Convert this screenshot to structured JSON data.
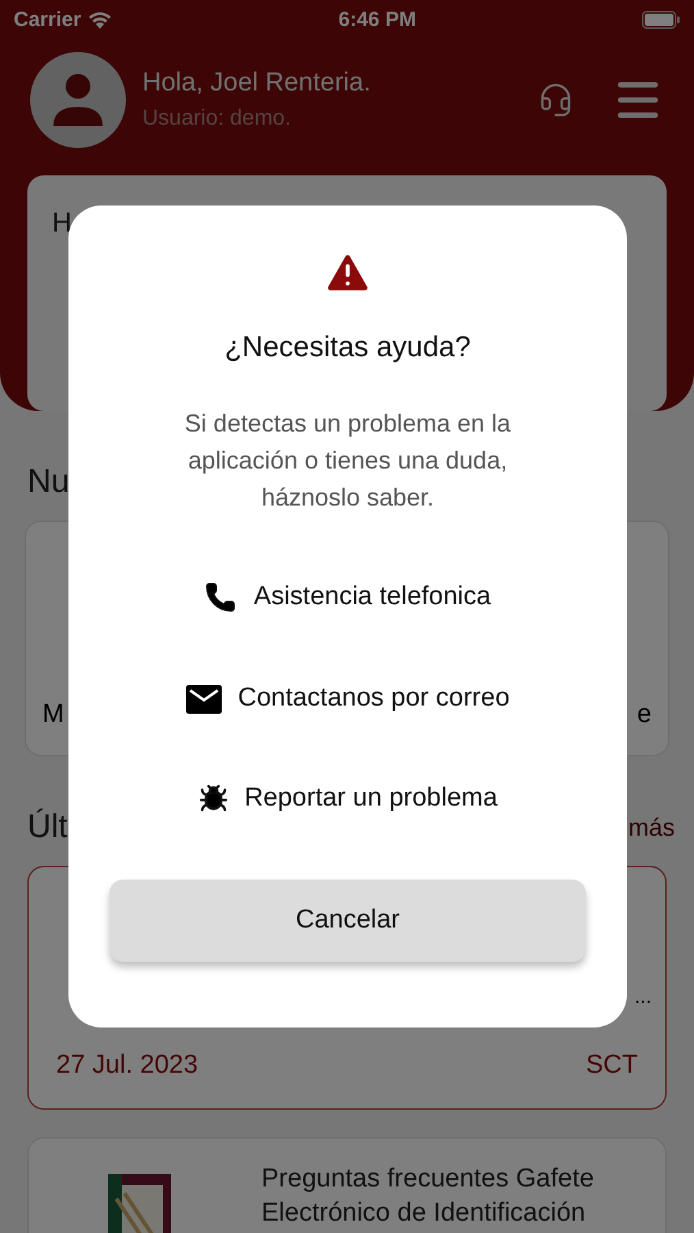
{
  "status_bar": {
    "carrier": "Carrier",
    "time": "6:46 PM"
  },
  "header": {
    "greeting": "Hola, Joel Renteria.",
    "user": "Usuario: demo."
  },
  "banner_card": {
    "text": "H"
  },
  "section_1": {
    "title": "Nu"
  },
  "feature_card": {
    "left_text": "M",
    "right_text": "e"
  },
  "section_2": {
    "title": "Últ",
    "link": "más"
  },
  "news": [
    {
      "kind": "highlight",
      "snippet": "...",
      "date": "27 Jul. 2023",
      "source": "SCT"
    },
    {
      "kind": "plain",
      "title": "Preguntas frecuentes Gafete Electrónico de Identificación"
    }
  ],
  "dialog": {
    "title": "¿Necesitas ayuda?",
    "message": "Si detectas un problema en la aplicación o tienes una duda, háznoslo saber.",
    "options": [
      {
        "kind": "phone",
        "label": "Asistencia telefonica"
      },
      {
        "kind": "mail",
        "label": "Contactanos por correo"
      },
      {
        "kind": "bug",
        "label": "Reportar un problema"
      }
    ],
    "cancel": "Cancelar"
  }
}
